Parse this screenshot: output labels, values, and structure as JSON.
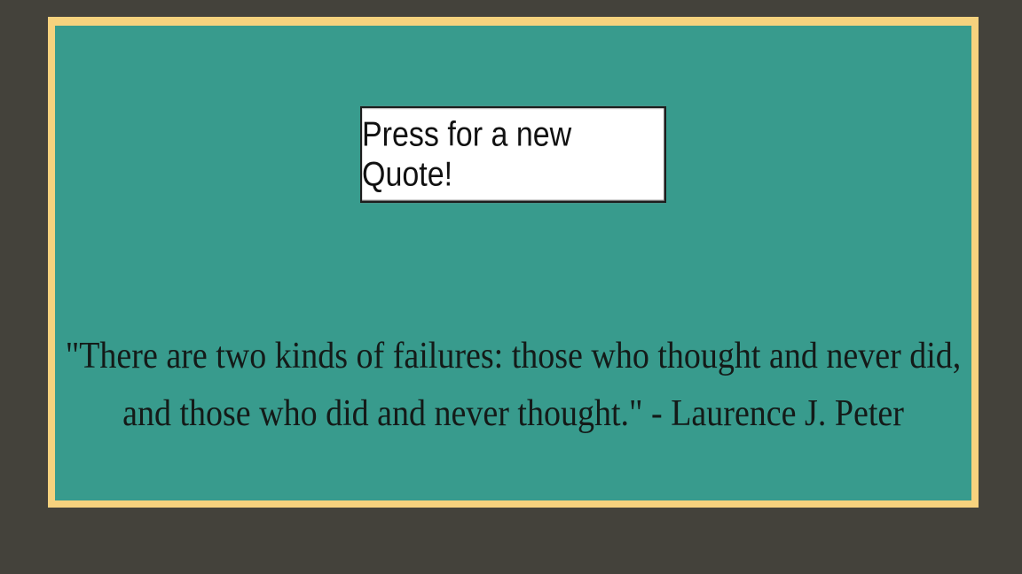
{
  "theme": {
    "background": "#44423b",
    "frame_border": "#f6d27e",
    "panel_background": "#389b8d",
    "button_background": "#ffffff"
  },
  "button": {
    "label": "Press for a new Quote!"
  },
  "quote": {
    "text": "\"There are two kinds of failures: those who thought and never did, and those who did and never thought.\" - Laurence J. Peter"
  }
}
